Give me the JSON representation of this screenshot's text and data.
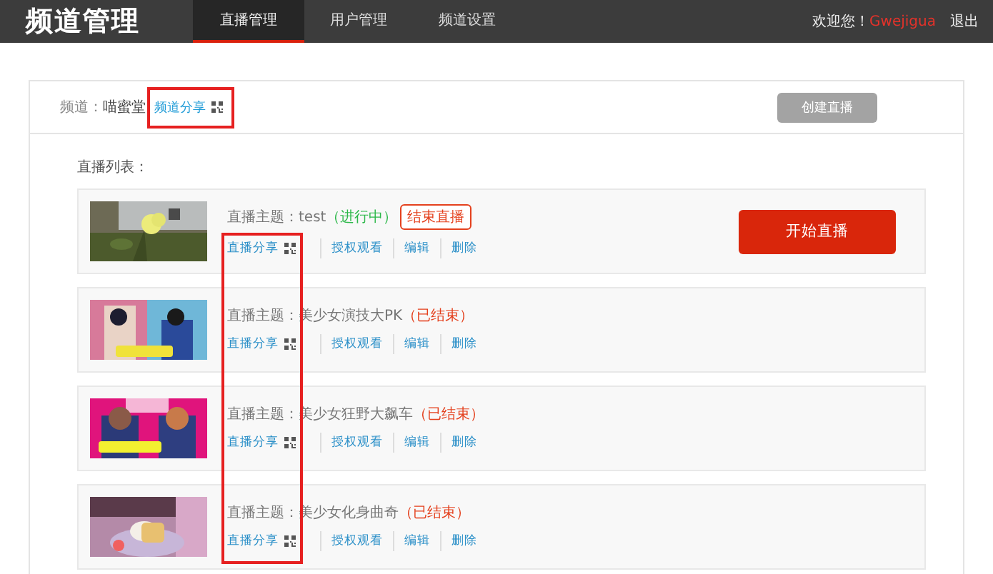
{
  "header": {
    "logo": "频道管理",
    "nav": [
      {
        "label": "直播管理",
        "selected": true
      },
      {
        "label": "用户管理",
        "selected": false
      },
      {
        "label": "频道设置",
        "selected": false
      }
    ],
    "welcome": "欢迎您！",
    "username": "Gwejigua",
    "logout": "退出"
  },
  "channel": {
    "label": "频道：",
    "name": "喵蜜堂",
    "share": "频道分享",
    "share_boxed": true,
    "create_button": "创建直播"
  },
  "list": {
    "title": "直播列表：",
    "share_column_boxed": true,
    "items": [
      {
        "kind": "live",
        "title": "直播主题：test",
        "status": "（进行中）",
        "end_button": "结束直播",
        "start_button": "开始直播",
        "links": [
          "直播分享",
          "授权观看",
          "编辑",
          "删除"
        ]
      },
      {
        "kind": "ended",
        "title": "直播主题：美少女演技大PK",
        "status": "（已结束）",
        "links": [
          "直播分享",
          "授权观看",
          "编辑",
          "删除"
        ]
      },
      {
        "kind": "ended",
        "title": "直播主题：美少女狂野大飙车",
        "status": "（已结束）",
        "links": [
          "直播分享",
          "授权观看",
          "编辑",
          "删除"
        ]
      },
      {
        "kind": "ended",
        "title": "直播主题：美少女化身曲奇",
        "status": "（已结束）",
        "links": [
          "直播分享",
          "授权观看",
          "编辑",
          "删除"
        ]
      }
    ]
  }
}
